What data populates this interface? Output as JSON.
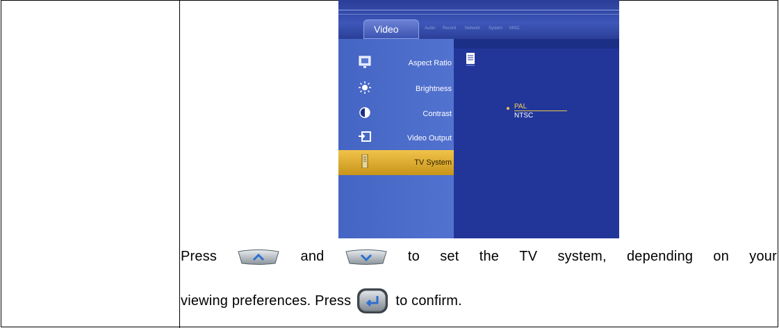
{
  "screenshot": {
    "active_tab": "Video",
    "other_tabs": [
      "Audio",
      "Record",
      "Network",
      "System",
      "MISC"
    ],
    "menu_items": [
      {
        "label": "Aspect Ratio",
        "icon": "aspect-ratio-icon"
      },
      {
        "label": "Brightness",
        "icon": "brightness-icon"
      },
      {
        "label": "Contrast",
        "icon": "contrast-icon"
      },
      {
        "label": "Video Output",
        "icon": "video-output-icon"
      },
      {
        "label": "TV System",
        "icon": "tv-system-icon",
        "selected": true
      }
    ],
    "options": [
      {
        "label": "PAL",
        "selected": true
      },
      {
        "label": "NTSC",
        "selected": false
      }
    ]
  },
  "instructions": {
    "line1": {
      "w1": "Press",
      "w2": "and",
      "w3": "to",
      "w4": "set",
      "w5": "the",
      "w6": "TV",
      "w7": "system,",
      "w8": "depending",
      "w9": "on",
      "w10": "your"
    },
    "line2": {
      "before": "viewing preferences. Press",
      "after": "to confirm."
    },
    "keys": [
      "up-arrow-key-icon",
      "down-arrow-key-icon",
      "enter-key-icon"
    ]
  },
  "colors": {
    "screen_bg": "#1c2f86",
    "menu_bg": "#4a6ac8",
    "selected_row": "#e0ad2e",
    "selected_option": "#f3d25a"
  }
}
